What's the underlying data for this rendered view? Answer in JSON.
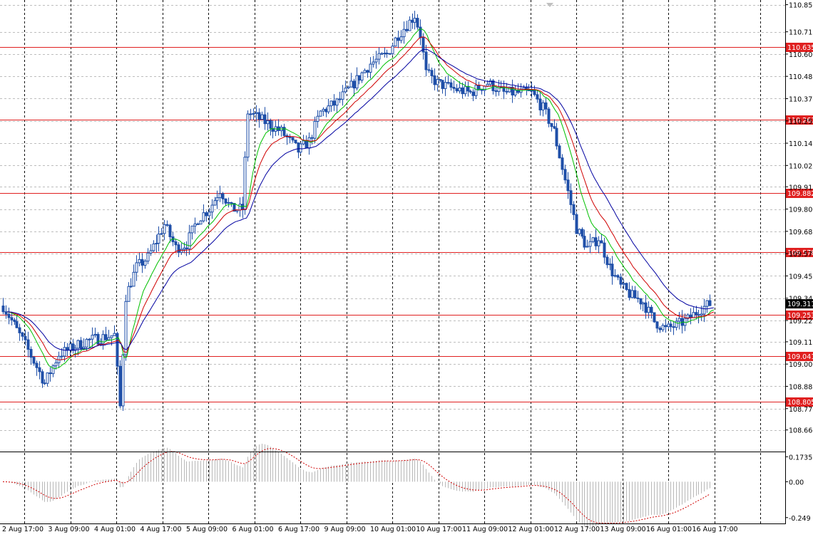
{
  "chart_data": [
    {
      "type": "candlestick",
      "symbol": "",
      "timeframe": "",
      "price_axis": {
        "range": [
          108.6,
          110.857
        ],
        "ticks": [
          "110.855",
          "110.715",
          "110.600",
          "110.485",
          "110.370",
          "110.255",
          "110.140",
          "110.025",
          "109.915",
          "109.800",
          "109.685",
          "109.570",
          "109.455",
          "109.340",
          "109.225",
          "109.115",
          "109.000",
          "108.885",
          "108.770",
          "108.660"
        ],
        "current_price": "109.311"
      },
      "time_axis": {
        "ticks": [
          "2 Aug 17:00",
          "3 Aug 09:00",
          "4 Aug 01:00",
          "4 Aug 17:00",
          "5 Aug 09:00",
          "6 Aug 01:00",
          "6 Aug 17:00",
          "9 Aug 09:00",
          "10 Aug 01:00",
          "10 Aug 17:00",
          "11 Aug 09:00",
          "12 Aug 01:00",
          "12 Aug 17:00",
          "13 Aug 09:00",
          "16 Aug 01:00",
          "16 Aug 17:00"
        ]
      },
      "horizontal_levels": [
        "110.635",
        "110.261",
        "109.882",
        "109.578",
        "109.253",
        "109.041",
        "108.805"
      ],
      "grid": true,
      "colors": {
        "background": "#ffffff",
        "candles": "#1f4fa8",
        "levels": "#e02020",
        "level_label_bg": "#e02020",
        "level_label_text": "#ffffff",
        "current_label_bg": "#000000",
        "current_label_text": "#ffffff",
        "ma_fast": "#00c000",
        "ma_mid": "#d00000",
        "ma_slow": "#0000a0",
        "grid": "#bdbdbd"
      },
      "price_path_keypoints": [
        [
          0,
          109.3
        ],
        [
          8,
          109.1
        ],
        [
          15,
          108.9
        ],
        [
          20,
          109.05
        ],
        [
          30,
          109.12
        ],
        [
          40,
          109.15
        ],
        [
          42,
          108.78
        ],
        [
          44,
          109.35
        ],
        [
          48,
          109.5
        ],
        [
          52,
          109.55
        ],
        [
          58,
          109.72
        ],
        [
          62,
          109.6
        ],
        [
          66,
          109.62
        ],
        [
          70,
          109.75
        ],
        [
          74,
          109.8
        ],
        [
          78,
          109.9
        ],
        [
          82,
          109.8
        ],
        [
          86,
          109.8
        ],
        [
          88,
          110.3
        ],
        [
          94,
          110.25
        ],
        [
          100,
          110.2
        ],
        [
          106,
          110.1
        ],
        [
          110,
          110.15
        ],
        [
          114,
          110.3
        ],
        [
          120,
          110.35
        ],
        [
          126,
          110.45
        ],
        [
          132,
          110.55
        ],
        [
          138,
          110.6
        ],
        [
          142,
          110.7
        ],
        [
          148,
          110.8
        ],
        [
          150,
          110.7
        ],
        [
          152,
          110.5
        ],
        [
          156,
          110.45
        ],
        [
          162,
          110.42
        ],
        [
          168,
          110.4
        ],
        [
          174,
          110.45
        ],
        [
          180,
          110.4
        ],
        [
          186,
          110.4
        ],
        [
          190,
          110.4
        ],
        [
          194,
          110.32
        ],
        [
          198,
          110.2
        ],
        [
          202,
          109.95
        ],
        [
          206,
          109.7
        ],
        [
          210,
          109.6
        ],
        [
          214,
          109.65
        ],
        [
          218,
          109.5
        ],
        [
          222,
          109.4
        ],
        [
          226,
          109.35
        ],
        [
          230,
          109.32
        ],
        [
          234,
          109.22
        ],
        [
          238,
          109.18
        ],
        [
          242,
          109.2
        ],
        [
          246,
          109.23
        ],
        [
          250,
          109.28
        ],
        [
          254,
          109.31
        ]
      ],
      "oscillator": {
        "ticks": [
          "0.1735",
          "0.00",
          "-0.249"
        ],
        "range": [
          -0.27,
          0.18
        ]
      }
    }
  ]
}
